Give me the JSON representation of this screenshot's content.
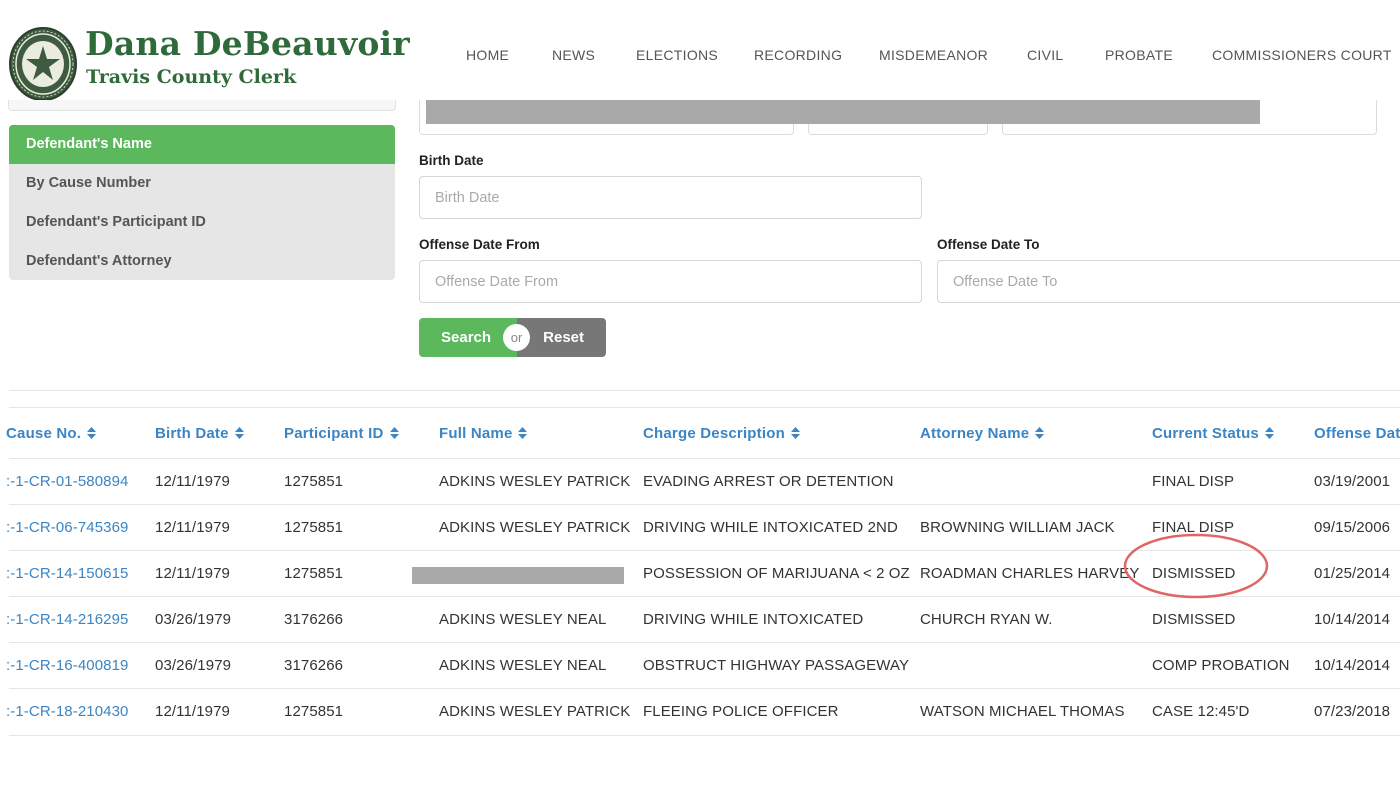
{
  "header": {
    "brand_name": "Dana DeBeauvoir",
    "brand_subtitle": "Travis County Clerk",
    "nav": [
      "HOME",
      "NEWS",
      "ELECTIONS",
      "RECORDING",
      "MISDEMEANOR",
      "CIVIL",
      "PROBATE",
      "COMMISSIONERS COURT"
    ]
  },
  "sidebar": {
    "items": [
      {
        "label": "Defendant's Name",
        "active": true
      },
      {
        "label": "By Cause Number",
        "active": false
      },
      {
        "label": "Defendant's Participant ID",
        "active": false
      },
      {
        "label": "Defendant's Attorney",
        "active": false
      }
    ]
  },
  "form": {
    "birth_date_label": "Birth Date",
    "birth_date_placeholder": "Birth Date",
    "offense_from_label": "Offense Date From",
    "offense_from_placeholder": "Offense Date From",
    "offense_to_label": "Offense Date To",
    "offense_to_placeholder": "Offense Date To",
    "search_label": "Search",
    "or_label": "or",
    "reset_label": "Reset"
  },
  "table": {
    "headers": [
      "Cause No.",
      "Birth Date",
      "Participant ID",
      "Full Name",
      "Charge Description",
      "Attorney Name",
      "Current Status",
      "Offense Dat"
    ],
    "rows": [
      {
        "cause": ":-1-CR-01-580894",
        "birth": "12/11/1979",
        "pid": "1275851",
        "name": "ADKINS WESLEY PATRICK",
        "charge": "EVADING ARREST OR DETENTION",
        "attorney": "",
        "status": "FINAL DISP",
        "offense": "03/19/2001"
      },
      {
        "cause": ":-1-CR-06-745369",
        "birth": "12/11/1979",
        "pid": "1275851",
        "name": "ADKINS WESLEY PATRICK",
        "charge": "DRIVING WHILE INTOXICATED 2ND",
        "attorney": "BROWNING WILLIAM JACK",
        "status": "FINAL DISP",
        "offense": "09/15/2006"
      },
      {
        "cause": ":-1-CR-14-150615",
        "birth": "12/11/1979",
        "pid": "1275851",
        "name": "",
        "charge": "POSSESSION OF MARIJUANA < 2 OZ",
        "attorney": "ROADMAN CHARLES HARVEY",
        "status": "DISMISSED",
        "offense": "01/25/2014"
      },
      {
        "cause": ":-1-CR-14-216295",
        "birth": "03/26/1979",
        "pid": "3176266",
        "name": "ADKINS WESLEY NEAL",
        "charge": "DRIVING WHILE INTOXICATED",
        "attorney": "CHURCH RYAN W.",
        "status": "DISMISSED",
        "offense": "10/14/2014"
      },
      {
        "cause": ":-1-CR-16-400819",
        "birth": "03/26/1979",
        "pid": "3176266",
        "name": "ADKINS WESLEY NEAL",
        "charge": "OBSTRUCT HIGHWAY PASSAGEWAY",
        "attorney": "",
        "status": "COMP PROBATION",
        "offense": "10/14/2014"
      },
      {
        "cause": ":-1-CR-18-210430",
        "birth": "12/11/1979",
        "pid": "1275851",
        "name": "ADKINS WESLEY PATRICK",
        "charge": "FLEEING POLICE OFFICER",
        "attorney": "WATSON MICHAEL THOMAS",
        "status": "CASE 12:45'D",
        "offense": "07/23/2018"
      }
    ]
  },
  "colors": {
    "brand_green": "#2f6b3a",
    "active_green": "#5cb85c",
    "link_blue": "#3b85c4",
    "reset_gray": "#777777",
    "highlight_red": "#e06666"
  },
  "icons": {
    "seal": "county-seal-icon",
    "sort": "sort-icon"
  }
}
